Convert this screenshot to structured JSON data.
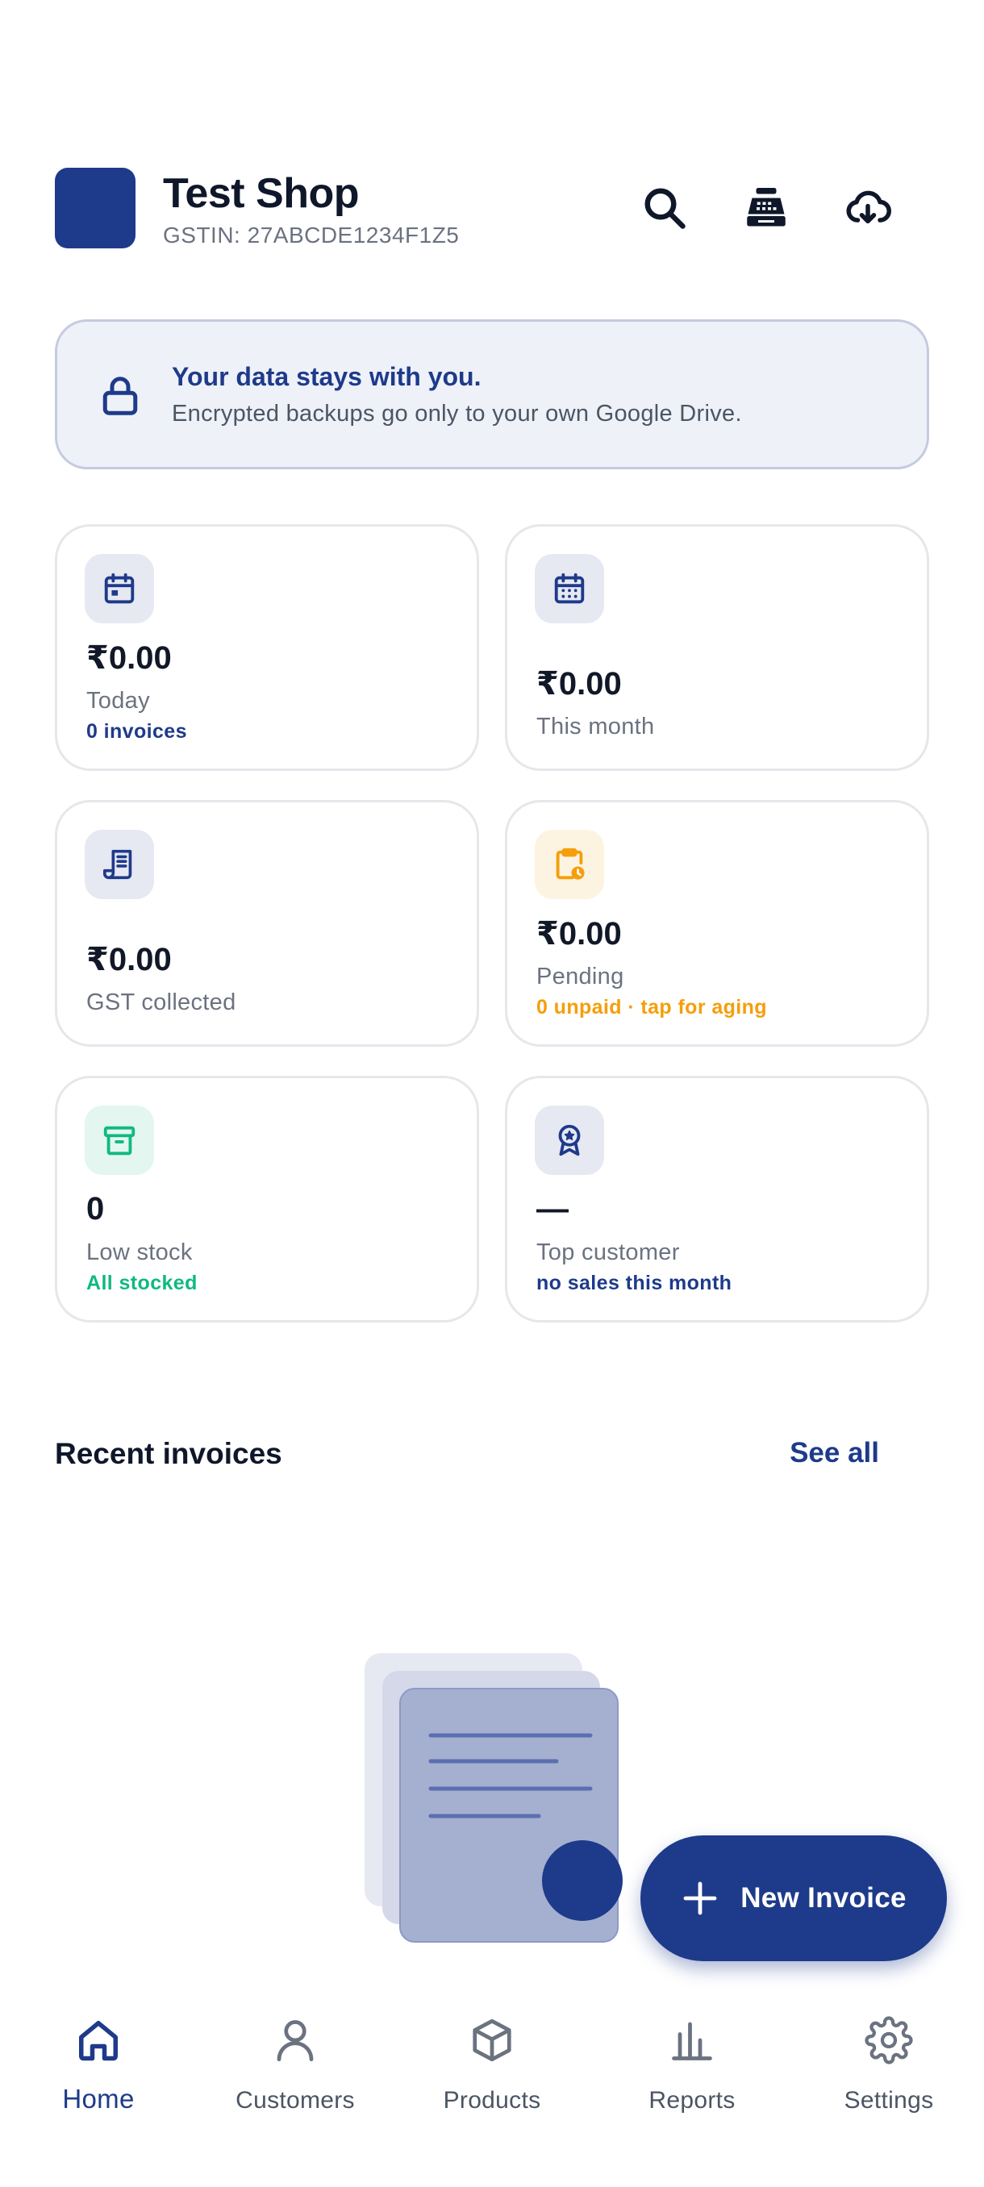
{
  "header": {
    "shop_name": "Test Shop",
    "gstin": "GSTIN: 27ABCDE1234F1Z5",
    "icons": [
      "search-icon",
      "cash-register-icon",
      "cloud-download-icon"
    ]
  },
  "banner": {
    "icon": "lock-icon",
    "title": "Your data stays with you.",
    "subtitle": "Encrypted backups go only to your own Google Drive."
  },
  "stats": [
    {
      "icon": "calendar-day-icon",
      "value": "₹0.00",
      "label": "Today",
      "sub": "0 invoices",
      "sub_color": "#1e3a8a"
    },
    {
      "icon": "calendar-month-icon",
      "value": "₹0.00",
      "label": "This month",
      "sub": ""
    },
    {
      "icon": "receipt-icon",
      "value": "₹0.00",
      "label": "GST collected",
      "sub": ""
    },
    {
      "icon": "clipboard-clock-icon",
      "value": "₹0.00",
      "label": "Pending",
      "sub": "0 unpaid · tap for aging",
      "sub_color": "#f59e0b"
    },
    {
      "icon": "archive-box-icon",
      "value": "0",
      "label": "Low stock",
      "sub": "All stocked",
      "sub_color": "#10b981"
    },
    {
      "icon": "award-badge-icon",
      "value": "—",
      "label": "Top customer",
      "sub": "no sales this month",
      "sub_color": "#1e3a8a"
    }
  ],
  "recent": {
    "title": "Recent invoices",
    "see_all": "See all"
  },
  "fab": {
    "label": "New Invoice"
  },
  "nav": {
    "items": [
      {
        "label": "Home",
        "icon": "home-icon",
        "active": true
      },
      {
        "label": "Customers",
        "icon": "person-icon",
        "active": false
      },
      {
        "label": "Products",
        "icon": "box-icon",
        "active": false
      },
      {
        "label": "Reports",
        "icon": "bar-chart-icon",
        "active": false
      },
      {
        "label": "Settings",
        "icon": "gear-icon",
        "active": false
      }
    ]
  },
  "colors": {
    "primary": "#1e3a8a",
    "amber": "#f59e0b",
    "green": "#10b981",
    "muted": "#6b7280"
  }
}
